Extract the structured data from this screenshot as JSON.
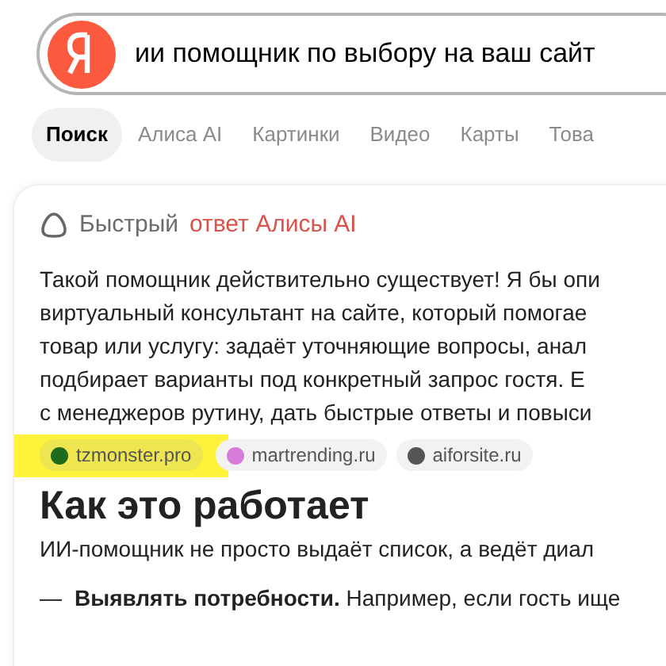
{
  "search": {
    "value": "ии помощник по выбору на ваш сайт"
  },
  "tabs": [
    {
      "label": "Поиск",
      "selected": true
    },
    {
      "label": "Алиса AI",
      "selected": false
    },
    {
      "label": "Картинки",
      "selected": false
    },
    {
      "label": "Видео",
      "selected": false
    },
    {
      "label": "Карты",
      "selected": false
    },
    {
      "label": "Това",
      "selected": false
    }
  ],
  "answer": {
    "title_parts": [
      {
        "text": "Быстрый",
        "accent": false
      },
      {
        "text": "ответ Алисы AI",
        "accent": true
      }
    ],
    "lines": [
      "Такой помощник действительно существует! Я бы опи",
      "виртуальный консультант на сайте, который помогае",
      "товар или услугу: задаёт уточняющие вопросы, анал",
      "подбирает варианты под конкретный запрос гостя. Е",
      "с менеджеров рутину, дать быстрые ответы и повыси"
    ],
    "sources": [
      {
        "label": "tzmonster.pro",
        "color": "#1e6b1e",
        "highlighted": true
      },
      {
        "label": "martrending.ru",
        "color": "#d77cd8",
        "highlighted": false
      },
      {
        "label": "aiforsite.ru",
        "color": "#555555",
        "highlighted": false
      }
    ],
    "heading": "Как это работает",
    "paragraph": "ИИ-помощник не просто выдаёт список, а ведёт диал",
    "bullets": [
      {
        "marker": "—",
        "text": "**Выявлять потребности.** Например, если гость ище"
      }
    ]
  }
}
